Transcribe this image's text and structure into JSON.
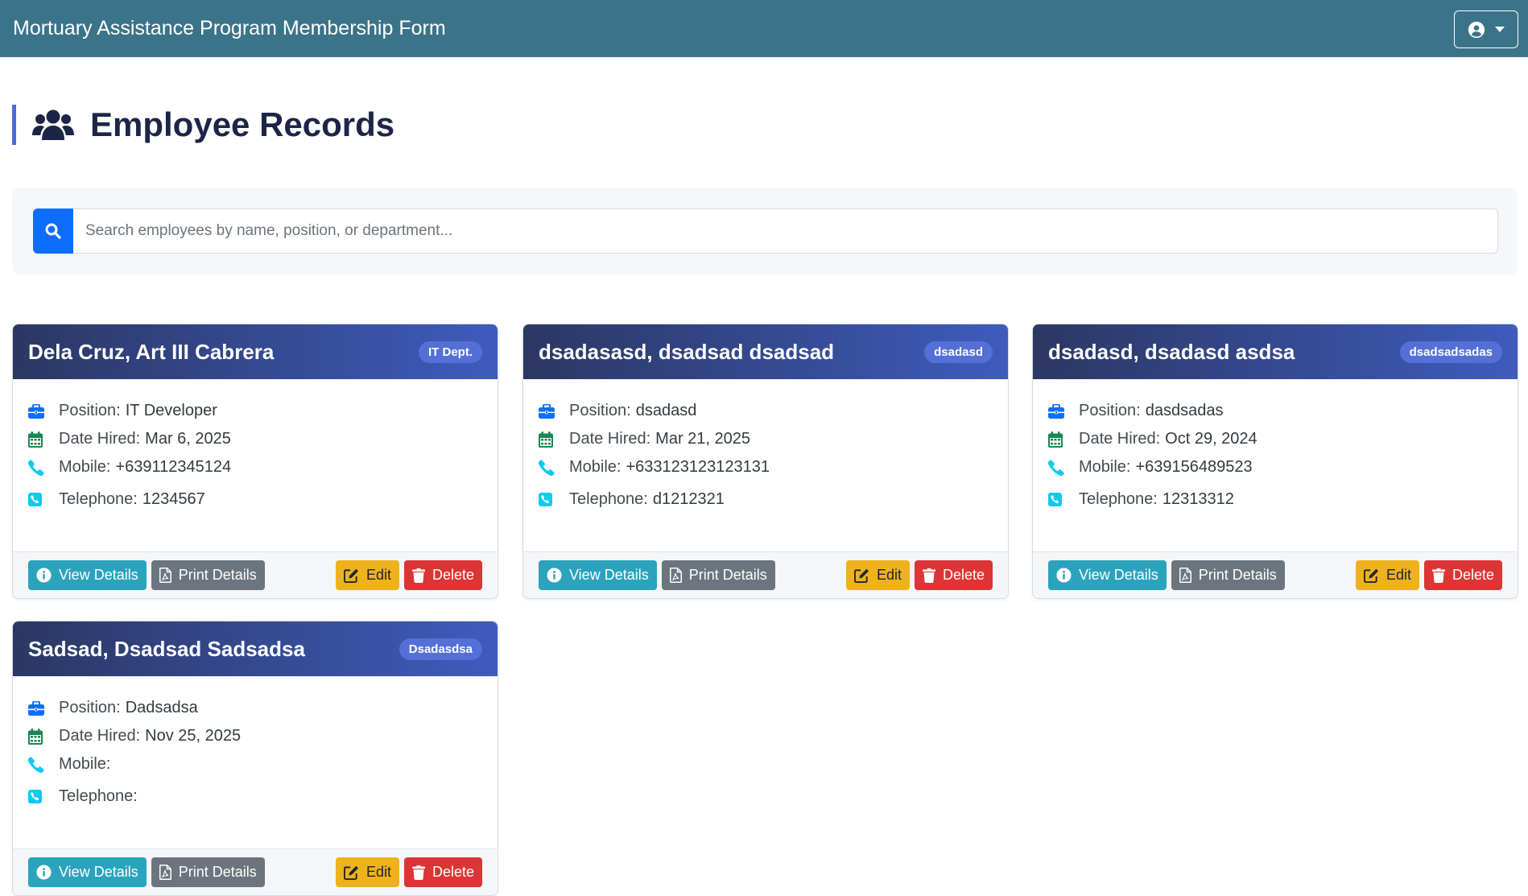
{
  "app": {
    "title": "Mortuary Assistance Program Membership Form"
  },
  "page": {
    "title": "Employee Records",
    "title_icon": "users-icon"
  },
  "search": {
    "placeholder": "Search employees by name, position, or department...",
    "icon": "search-icon"
  },
  "labels": {
    "position": "Position:",
    "date_hired": "Date Hired:",
    "mobile": "Mobile:",
    "telephone": "Telephone:",
    "view": "View Details",
    "print": "Print Details",
    "edit": "Edit",
    "delete": "Delete"
  },
  "colors": {
    "navbar": "#3b7489",
    "accent": "#0d6efd",
    "card_header_start": "#2b3763",
    "card_header_end": "#3f5bbd",
    "badge": "#5470d6",
    "view_button": "#2ba3bd",
    "print_button": "#6c757d",
    "edit_button": "#eeb21d",
    "delete_button": "#dc3535"
  },
  "employees": [
    {
      "name": "Dela Cruz, Art III Cabrera",
      "department": "IT Dept.",
      "position": "IT Developer",
      "date_hired": "Mar 6, 2025",
      "mobile": "+639112345124",
      "telephone": "1234567"
    },
    {
      "name": "dsadasasd, dsadsad dsadsad",
      "department": "dsadasd",
      "position": "dsadasd",
      "date_hired": "Mar 21, 2025",
      "mobile": "+633123123123131",
      "telephone": "d1212321"
    },
    {
      "name": "dsadasd, dsadasd asdsa",
      "department": "dsadsadsadas",
      "position": "dasdsadas",
      "date_hired": "Oct 29, 2024",
      "mobile": "+639156489523",
      "telephone": "12313312"
    },
    {
      "name": "Sadsad, Dsadsad Sadsadsa",
      "department": "Dsadasdsa",
      "position": "Dadsadsa",
      "date_hired": "Nov 25, 2025",
      "mobile": "",
      "telephone": ""
    }
  ]
}
